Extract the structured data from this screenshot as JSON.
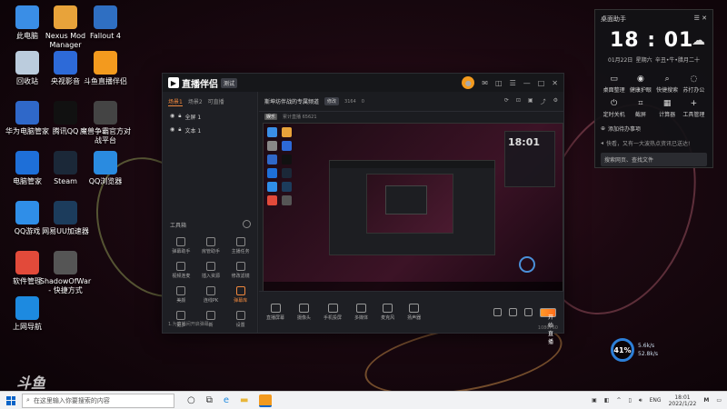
{
  "desktop_icons": [
    {
      "label": "此电脑",
      "icon": "computer-icon",
      "color": "#3a8ee6"
    },
    {
      "label": "Nexus Mod Manager",
      "icon": "nexus-icon",
      "color": "#e8a33a"
    },
    {
      "label": "Fallout 4",
      "icon": "fallout-icon",
      "color": "#2f6fc2"
    },
    {
      "label": "回收站",
      "icon": "recycle-bin-icon",
      "color": "#bcd"
    },
    {
      "label": "央视影音",
      "icon": "cctv-icon",
      "color": "#2d6ad8"
    },
    {
      "label": "斗鱼直播伴侣",
      "icon": "douyu-icon",
      "color": "#f39a1e"
    },
    {
      "label": "华为电脑管家",
      "icon": "huawei-icon",
      "color": "#2f68c9"
    },
    {
      "label": "腾讯QQ",
      "icon": "qq-icon",
      "color": "#111"
    },
    {
      "label": "魔兽争霸官方对战平台",
      "icon": "warcraft-icon",
      "color": "#444"
    },
    {
      "label": "电脑管家",
      "icon": "tencent-guard-icon",
      "color": "#1e6fd8"
    },
    {
      "label": "Steam",
      "icon": "steam-icon",
      "color": "#1b2838"
    },
    {
      "label": "QQ浏览器",
      "icon": "qq-browser-icon",
      "color": "#2a8be0"
    },
    {
      "label": "QQ游戏",
      "icon": "qq-game-icon",
      "color": "#2f8ee8"
    },
    {
      "label": "网易UU加速器",
      "icon": "uu-icon",
      "color": "#1c3c5c"
    },
    {
      "label": "软件管理",
      "icon": "software-manager-icon",
      "color": "#e24a3a"
    },
    {
      "label": "ShadowOfWar - 快捷方式",
      "icon": "shadow-of-war-icon",
      "color": "#555"
    },
    {
      "label": "上网导航",
      "icon": "ie-icon",
      "color": "#1d8ae0"
    }
  ],
  "app": {
    "title": "直播伴侣",
    "badge": "测试",
    "left_tabs": [
      "场景1",
      "场景2",
      "可直播"
    ],
    "scene_items": [
      "全屏 1",
      "文本 1"
    ],
    "tools_title": "工具箱",
    "tools": [
      {
        "label": "弹幕助手"
      },
      {
        "label": "房管助手"
      },
      {
        "label": "主播任务"
      },
      {
        "label": "视频连麦"
      },
      {
        "label": "插入资源"
      },
      {
        "label": "修改滤镜"
      },
      {
        "label": "美颜"
      },
      {
        "label": "连线PK"
      },
      {
        "label": "弹幕库"
      },
      {
        "label": "更多"
      },
      {
        "label": "新"
      },
      {
        "label": "设置"
      }
    ],
    "left_footer": "1.为直播间开启弹幕",
    "room_title": "斯坤坊伴战的专属频道",
    "edit_label": "修改",
    "stat_a": "3164",
    "stat_b": "0",
    "sub_tag": "娱乐",
    "sub_text": "累计直播 65621",
    "controls": [
      {
        "label": "直播屏幕"
      },
      {
        "label": "摄像头"
      },
      {
        "label": "手机投屏"
      },
      {
        "label": "多媒体"
      },
      {
        "label": "麦克风"
      },
      {
        "label": "扬声器"
      }
    ],
    "start_label": "开始直播",
    "status": "1080P60"
  },
  "preview_widget": {
    "time": "18:01"
  },
  "widget": {
    "title": "桌面助手",
    "time": "18 : 01",
    "date_left": "01月22日",
    "date_mid": "星期六",
    "date_right": "辛丑•牛•腊月二十",
    "items": [
      {
        "icon": "monitor-icon",
        "glyph": "▭",
        "label": "桌面整理"
      },
      {
        "icon": "eye-icon",
        "glyph": "◉",
        "label": "健康护眼"
      },
      {
        "icon": "search-icon",
        "glyph": "⌕",
        "label": "快捷搜索"
      },
      {
        "icon": "headset-icon",
        "glyph": "◌",
        "label": "苏打办公"
      },
      {
        "icon": "power-icon",
        "glyph": "⏻",
        "label": "定时关机"
      },
      {
        "icon": "crop-icon",
        "glyph": "⌗",
        "label": "截屏"
      },
      {
        "icon": "calculator-icon",
        "glyph": "▦",
        "label": "计算器"
      },
      {
        "icon": "toolbox-icon",
        "glyph": "+",
        "label": "工具管理"
      }
    ],
    "add_event": "添加待办事项",
    "tip": "快看，又有一大波热点资讯已送达!",
    "search_placeholder": "搜索网页、查找文件"
  },
  "watermark": "斗鱼",
  "perf": {
    "percent": "41%",
    "up": "5.6k/s",
    "down": "52.8k/s"
  },
  "taskbar": {
    "search_placeholder": "在这里输入你要搜索的内容",
    "lang": "ENG",
    "time": "18:01",
    "date": "2022/1/22"
  }
}
